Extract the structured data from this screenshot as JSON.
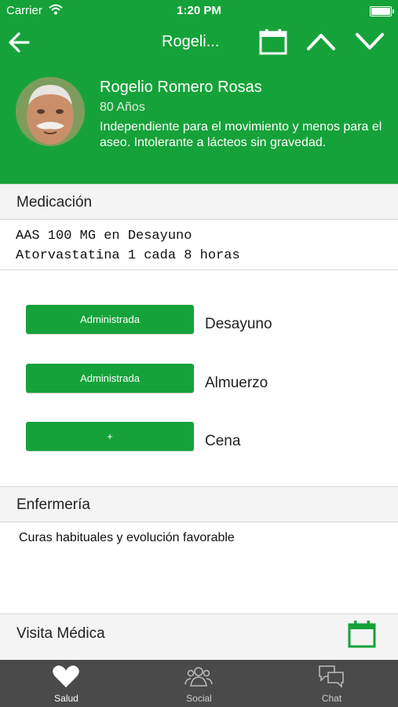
{
  "status_bar": {
    "carrier": "Carrier",
    "time": "1:20 PM"
  },
  "nav": {
    "title": "Rogeli..."
  },
  "patient": {
    "name": "Rogelio Romero Rosas",
    "age": "80 Años",
    "description": "Independiente para el movimiento y menos para el aseo. Intolerante a lácteos sin gravedad."
  },
  "medication": {
    "header": "Medicación",
    "lines": [
      "AAS 100 MG en Desayuno",
      "Atorvastatina 1 cada 8 horas"
    ],
    "doses": [
      {
        "button": "Administrada",
        "meal": "Desayuno"
      },
      {
        "button": "Administrada",
        "meal": "Almuerzo"
      },
      {
        "button": "+",
        "meal": "Cena"
      }
    ]
  },
  "nursing": {
    "header": "Enfermería",
    "text": "Curas habituales y evolución favorable"
  },
  "visit": {
    "header": "Visita Médica"
  },
  "tabs": [
    {
      "label": "Salud",
      "icon": "heart-icon",
      "active": true
    },
    {
      "label": "Social",
      "icon": "people-icon",
      "active": false
    },
    {
      "label": "Chat",
      "icon": "chat-bubbles-icon",
      "active": false
    }
  ],
  "colors": {
    "primary": "#16a23a",
    "tabbar": "#4a4a4a",
    "section_bg": "#f4f4f4"
  }
}
